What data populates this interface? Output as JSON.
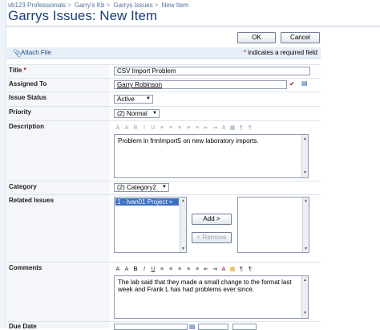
{
  "breadcrumb": [
    "vb123 Professionals",
    "Garry's Kb",
    "Garrys Issues",
    "New Item"
  ],
  "page_title": "Garrys Issues: New Item",
  "buttons": {
    "ok": "OK",
    "cancel": "Cancel",
    "add": "Add >",
    "remove": "< Remove"
  },
  "attach": {
    "label": "Attach File",
    "required_note": "indicates a required field"
  },
  "fields": {
    "title": {
      "label": "Title",
      "value": "CSV Import Problem"
    },
    "assigned_to": {
      "label": "Assigned To",
      "value": "Garry Robinson"
    },
    "issue_status": {
      "label": "Issue Status",
      "value": "Active"
    },
    "priority": {
      "label": "Priority",
      "value": "(2) Normal"
    },
    "description": {
      "label": "Description",
      "value": "Problem in frmImport5 on new laboratory imports."
    },
    "category": {
      "label": "Category",
      "value": "(2) Category2"
    },
    "related_issues": {
      "label": "Related Issues",
      "selected_item": "1 - Ivan01 Project ≈"
    },
    "comments": {
      "label": "Comments",
      "value": "The lab said that they made a small change to the format last week and Frank L has had problems ever since."
    },
    "due_date": {
      "label": "Due Date"
    }
  },
  "toolbar_icons": [
    "font-icon",
    "font-size-icon",
    "bold-icon",
    "italic-icon",
    "underline-icon",
    "align-left-icon",
    "align-center-icon",
    "align-right-icon",
    "numbered-list-icon",
    "bullet-list-icon",
    "outdent-icon",
    "indent-icon",
    "font-color-icon",
    "background-color-icon",
    "ltr-icon",
    "rtl-icon"
  ],
  "colors": {
    "title": "#1b3f78",
    "link": "#1f4a85",
    "required": "#c00000",
    "selection": "#3a6fc4"
  }
}
